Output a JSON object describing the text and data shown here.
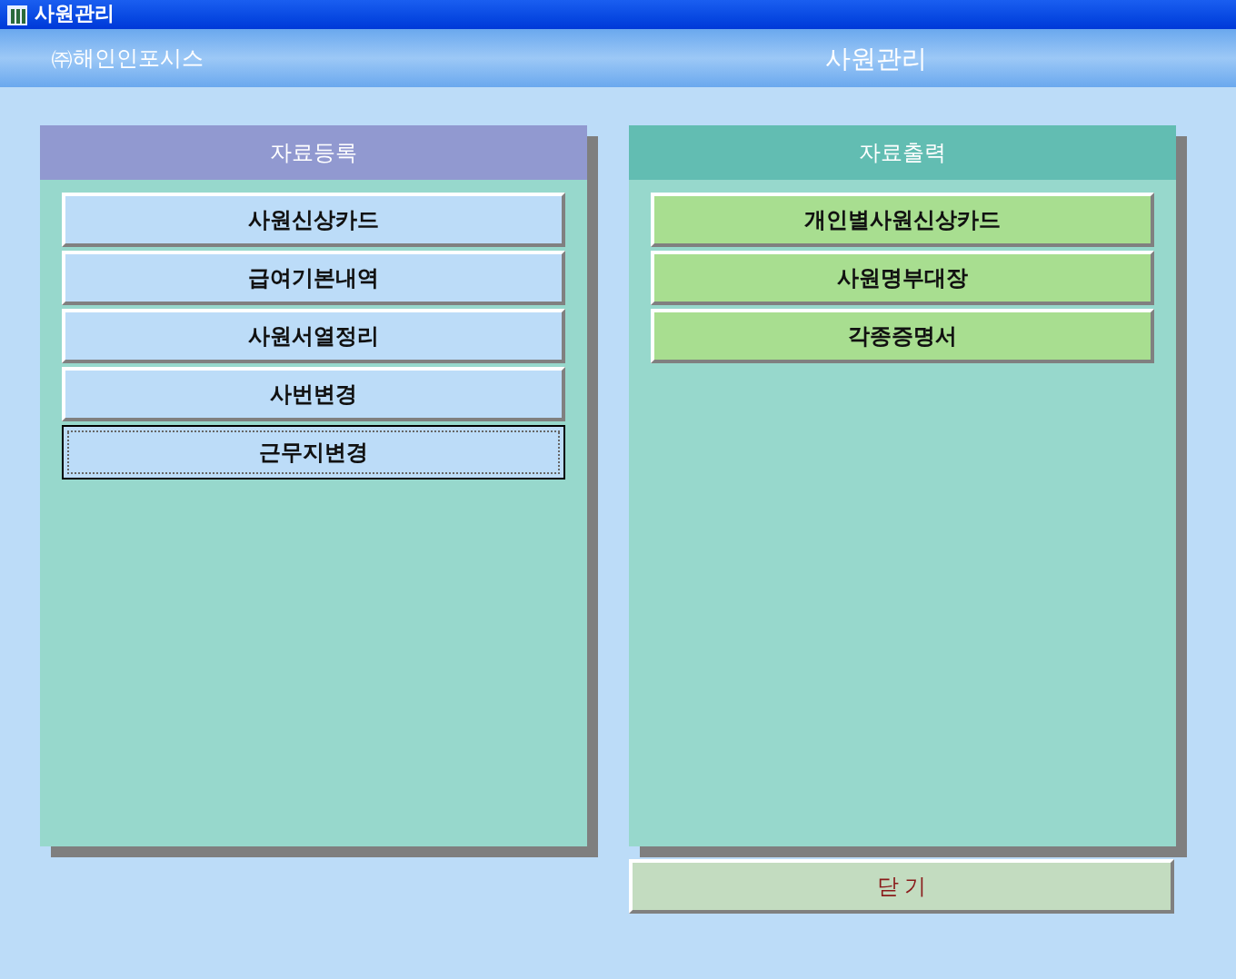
{
  "window": {
    "title": "사원관리"
  },
  "header": {
    "company": "㈜해인인포시스",
    "title": "사원관리"
  },
  "panels": [
    {
      "title": "자료등록",
      "kind": "input",
      "buttons": [
        {
          "label": "사원신상카드",
          "focused": false
        },
        {
          "label": "급여기본내역",
          "focused": false
        },
        {
          "label": "사원서열정리",
          "focused": false
        },
        {
          "label": "사번변경",
          "focused": false
        },
        {
          "label": "근무지변경",
          "focused": true
        }
      ]
    },
    {
      "title": "자료출력",
      "kind": "output",
      "buttons": [
        {
          "label": "개인별사원신상카드",
          "focused": false
        },
        {
          "label": "사원명부대장",
          "focused": false
        },
        {
          "label": "각종증명서",
          "focused": false
        }
      ]
    }
  ],
  "close_button": "닫 기"
}
